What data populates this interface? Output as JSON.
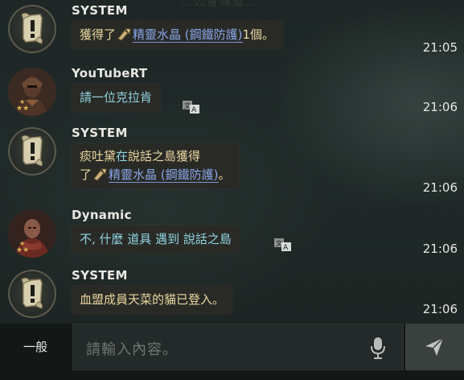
{
  "watermark": "…公會頻道…",
  "messages": [
    {
      "sender": "SYSTEM",
      "kind": "system",
      "parts_1": "獲得了",
      "item": "精靈水晶 (鋼鐵防護)",
      "parts_2": "1個。",
      "time": "21:05",
      "avatar_icon": "scroll-icon"
    },
    {
      "sender": "YouTubeRT",
      "kind": "user",
      "text": "請一位克拉肯",
      "time": "21:06",
      "avatar_icon": "knight-portrait"
    },
    {
      "sender": "SYSTEM",
      "kind": "system",
      "line1_a": "痰吐黛",
      "line1_b": "在",
      "line1_c": "說話之島",
      "line1_d": "獲得",
      "line2_a": "了",
      "item": "精靈水晶 (鋼鐵防護)",
      "line2_b": "。",
      "time": "21:06",
      "avatar_icon": "scroll-icon"
    },
    {
      "sender": "Dynamic",
      "kind": "user",
      "text": "不, 什麼 道具 遇到 說話之島",
      "time": "21:06",
      "avatar_icon": "warrior-portrait"
    },
    {
      "sender": "SYSTEM",
      "kind": "system",
      "text": "血盟成員天菜的貓已登入。",
      "time": "21:06",
      "avatar_icon": "scroll-icon"
    }
  ],
  "input_bar": {
    "channel": "一般",
    "placeholder": "請輸入內容。"
  },
  "colors": {
    "system_text": "#e9d7a0",
    "user_text": "#8fd3e0",
    "item_link": "#8aa6e8",
    "background": "#1e2725"
  }
}
